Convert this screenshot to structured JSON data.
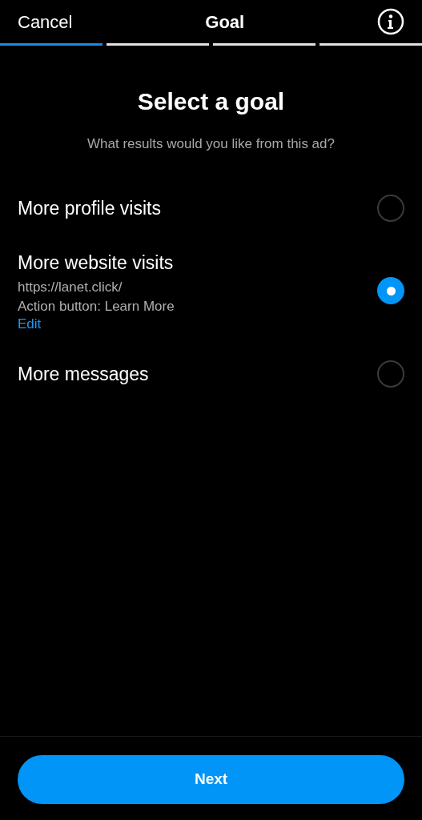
{
  "header": {
    "cancel": "Cancel",
    "title": "Goal"
  },
  "progress": [
    {
      "active": true
    },
    {
      "active": false
    },
    {
      "active": false
    },
    {
      "active": false
    }
  ],
  "heading": "Select a goal",
  "subheading": "What results would you like from this ad?",
  "options": [
    {
      "label": "More profile visits",
      "selected": false
    },
    {
      "label": "More website visits",
      "selected": true,
      "details": [
        "https://lanet.click/",
        "Action button: Learn More"
      ],
      "link": "Edit"
    },
    {
      "label": "More messages",
      "selected": false
    }
  ],
  "button": "Next"
}
